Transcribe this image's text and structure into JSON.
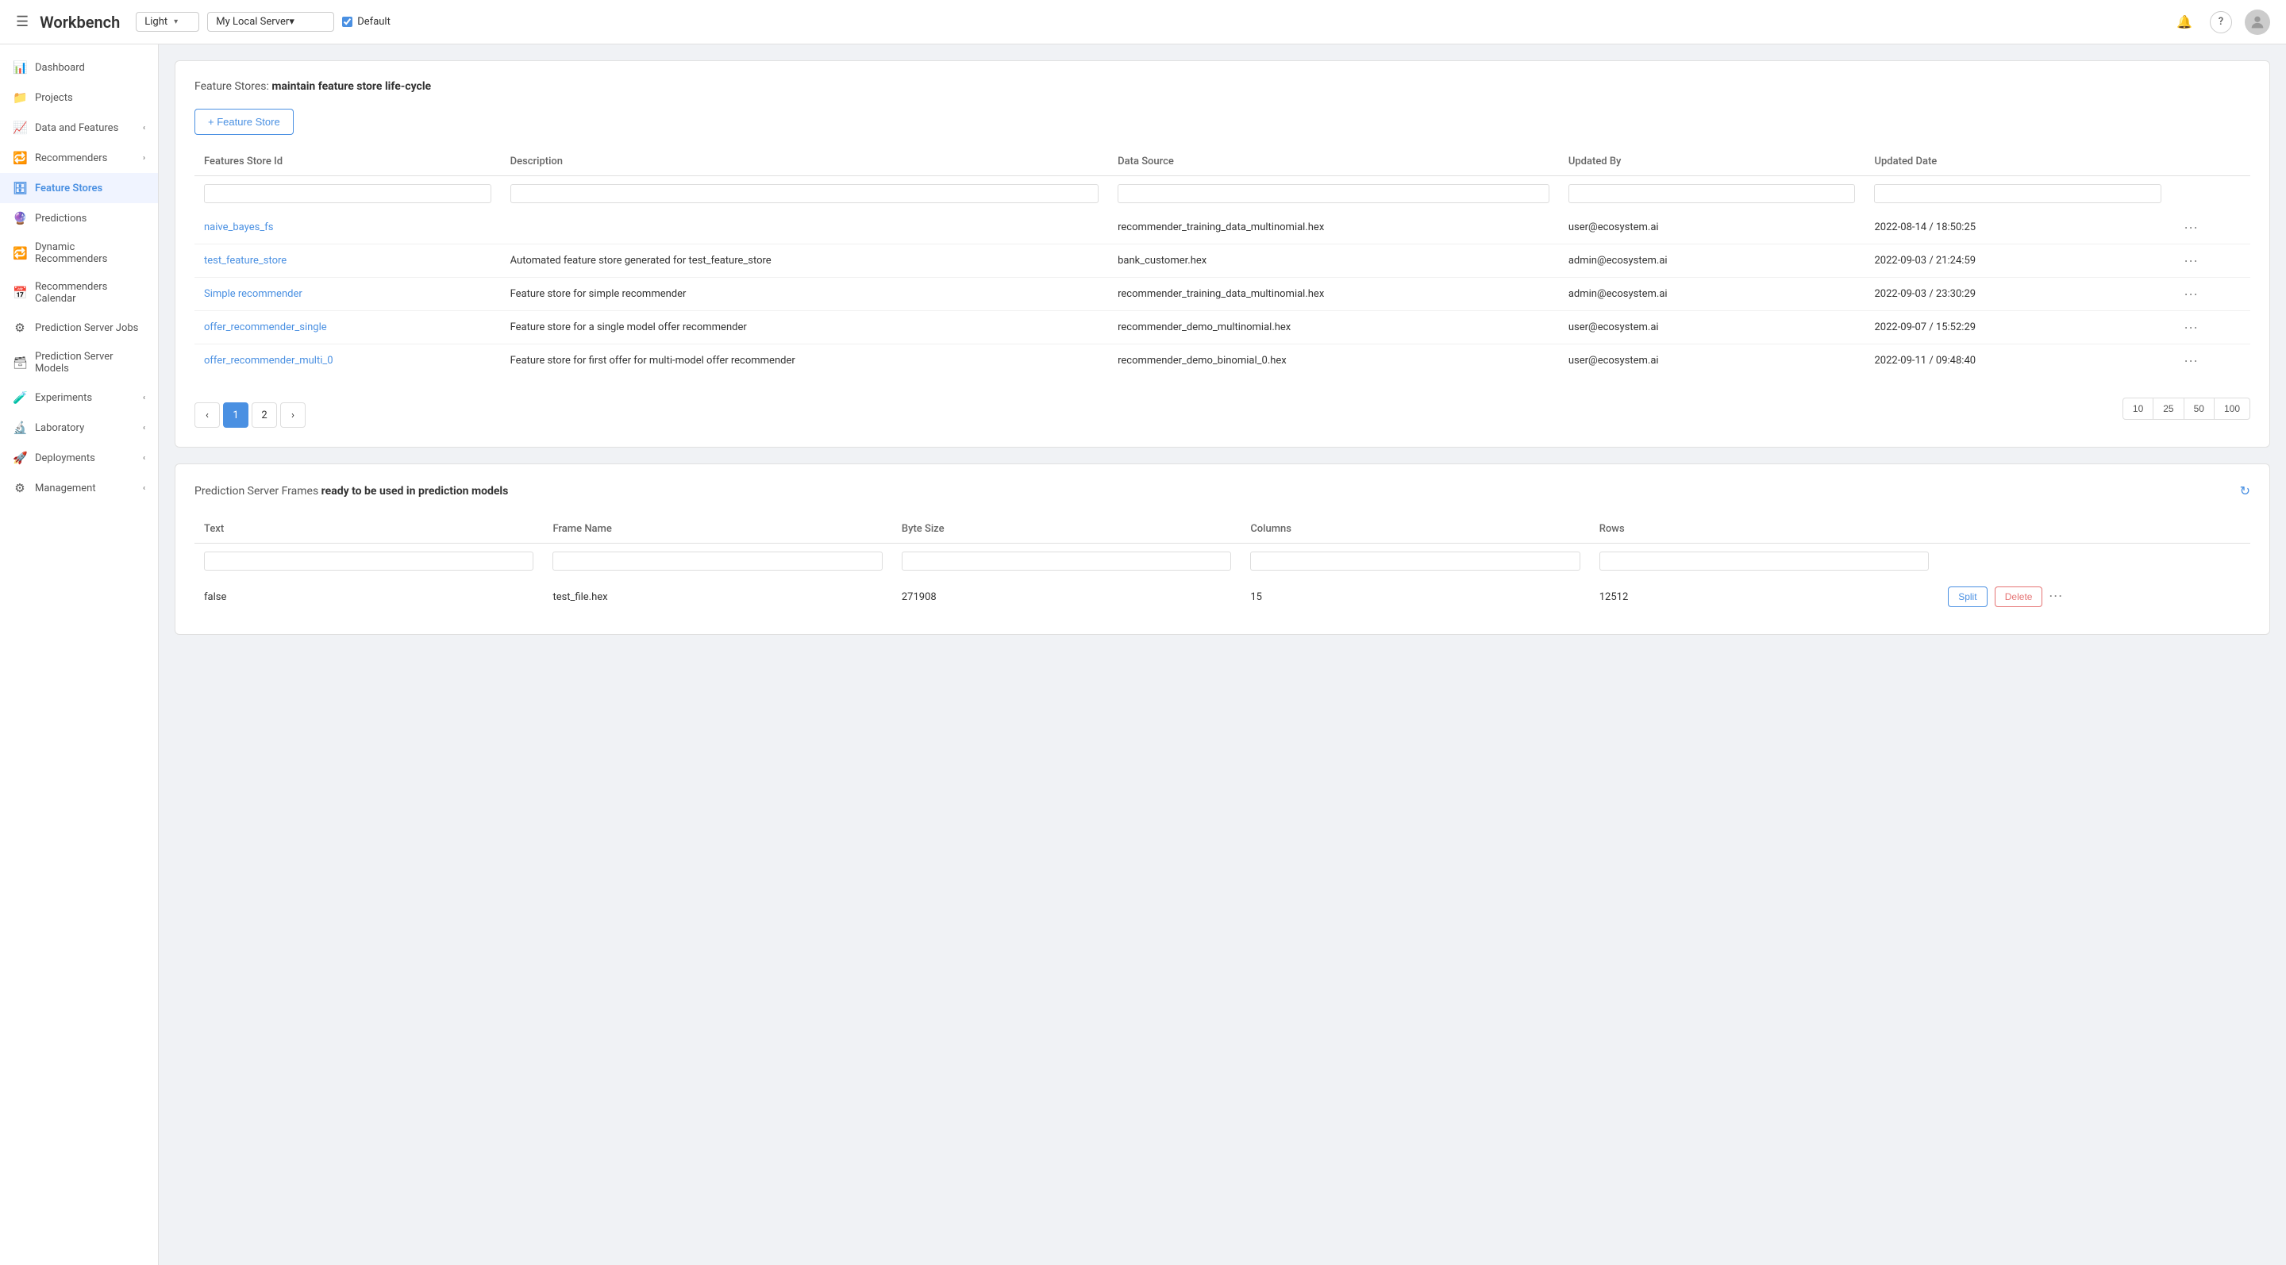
{
  "header": {
    "menu_icon": "☰",
    "logo": "Workbench",
    "theme_label": "Light",
    "server_label": "My Local Server",
    "default_label": "Default",
    "bell_icon": "🔔",
    "help_icon": "?",
    "avatar_icon": "👤"
  },
  "sidebar": {
    "items": [
      {
        "id": "dashboard",
        "label": "Dashboard",
        "icon": "📊",
        "has_chevron": false
      },
      {
        "id": "projects",
        "label": "Projects",
        "icon": "📁",
        "has_chevron": false
      },
      {
        "id": "data-features",
        "label": "Data and Features",
        "icon": "📈",
        "has_chevron": true,
        "chevron": "‹"
      },
      {
        "id": "recommenders",
        "label": "Recommenders",
        "icon": "🔁",
        "has_chevron": true,
        "chevron": "›"
      },
      {
        "id": "feature-stores",
        "label": "Feature Stores",
        "icon": "🗄",
        "has_chevron": false,
        "active": true
      },
      {
        "id": "predictions",
        "label": "Predictions",
        "icon": "🔮",
        "has_chevron": false
      },
      {
        "id": "dynamic-recommenders",
        "label": "Dynamic Recommenders",
        "icon": "🔁",
        "has_chevron": false
      },
      {
        "id": "recommenders-calendar",
        "label": "Recommenders Calendar",
        "icon": "📅",
        "has_chevron": false
      },
      {
        "id": "prediction-server-jobs",
        "label": "Prediction Server Jobs",
        "icon": "⚙",
        "has_chevron": false
      },
      {
        "id": "prediction-server-models",
        "label": "Prediction Server Models",
        "icon": "🗃",
        "has_chevron": false
      },
      {
        "id": "experiments",
        "label": "Experiments",
        "icon": "🧪",
        "has_chevron": true,
        "chevron": "‹"
      },
      {
        "id": "laboratory",
        "label": "Laboratory",
        "icon": "🔬",
        "has_chevron": true,
        "chevron": "‹"
      },
      {
        "id": "deployments",
        "label": "Deployments",
        "icon": "🚀",
        "has_chevron": true,
        "chevron": "‹"
      },
      {
        "id": "management",
        "label": "Management",
        "icon": "⚙",
        "has_chevron": true,
        "chevron": "‹"
      }
    ]
  },
  "feature_stores_section": {
    "title_prefix": "Feature Stores: ",
    "title_bold": "maintain feature store life-cycle",
    "add_button": "+ Feature Store",
    "columns": [
      "Features Store Id",
      "Description",
      "Data Source",
      "Updated By",
      "Updated Date"
    ],
    "rows": [
      {
        "id": "naive_bayes_fs",
        "description": "",
        "data_source": "recommender_training_data_multinomial.hex",
        "updated_by": "user@ecosystem.ai",
        "updated_date": "2022-08-14 / 18:50:25"
      },
      {
        "id": "test_feature_store",
        "description": "Automated feature store generated for test_feature_store",
        "data_source": "bank_customer.hex",
        "updated_by": "admin@ecosystem.ai",
        "updated_date": "2022-09-03 / 21:24:59"
      },
      {
        "id": "Simple recommender",
        "description": "Feature store for simple recommender",
        "data_source": "recommender_training_data_multinomial.hex",
        "updated_by": "admin@ecosystem.ai",
        "updated_date": "2022-09-03 / 23:30:29"
      },
      {
        "id": "offer_recommender_single",
        "description": "Feature store for a single model offer recommender",
        "data_source": "recommender_demo_multinomial.hex",
        "updated_by": "user@ecosystem.ai",
        "updated_date": "2022-09-07 / 15:52:29"
      },
      {
        "id": "offer_recommender_multi_0",
        "description": "Feature store for first offer for multi-model offer recommender",
        "data_source": "recommender_demo_binomial_0.hex",
        "updated_by": "user@ecosystem.ai",
        "updated_date": "2022-09-11 / 09:48:40"
      }
    ],
    "pagination": {
      "prev": "‹",
      "pages": [
        "1",
        "2"
      ],
      "next": "›",
      "active_page": "1"
    },
    "page_sizes": [
      "10",
      "25",
      "50",
      "100"
    ]
  },
  "prediction_frames_section": {
    "title_prefix": "Prediction Server Frames ",
    "title_bold": "ready to be used in prediction models",
    "refresh_icon": "↻",
    "columns": [
      "Text",
      "Frame Name",
      "Byte Size",
      "Columns",
      "Rows"
    ],
    "rows": [
      {
        "text": "false",
        "frame_name": "test_file.hex",
        "byte_size": "271908",
        "columns": "15",
        "rows": "12512",
        "split_label": "Split",
        "delete_label": "Delete"
      }
    ]
  }
}
